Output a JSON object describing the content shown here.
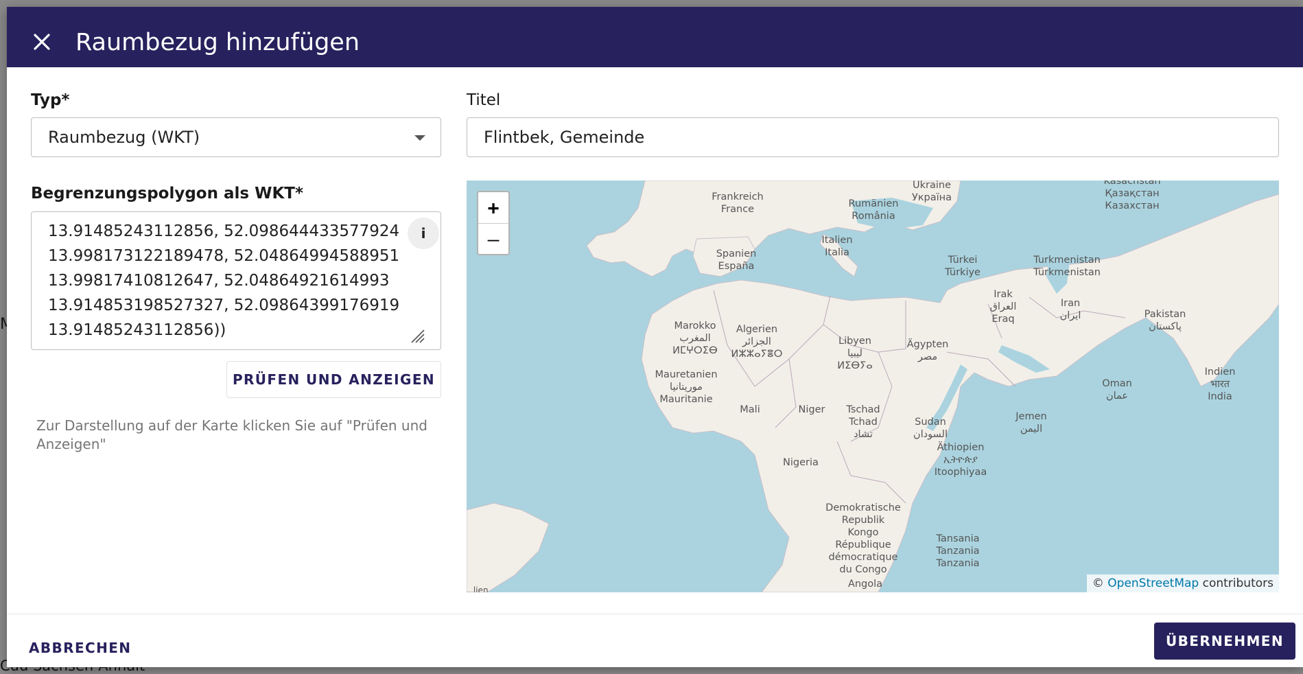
{
  "backdrop": {
    "left_text": "M",
    "bottom_text": "Cüü Sachsen-Anhalt"
  },
  "dialog": {
    "title": "Raumbezug hinzufügen",
    "close_icon": "close-icon"
  },
  "form": {
    "type_label": "Typ*",
    "type_value": "Raumbezug (WKT)",
    "title_label": "Titel",
    "title_value": "Flintbek, Gemeinde",
    "wkt_label": "Begrenzungspolygon als WKT*",
    "wkt_lines": [
      "13.91485243112856, 52.098644433577924",
      "13.998173122189478, 52.04864994588951",
      "13.99817410812647, 52.04864921614993",
      "13.914853198527327, 52.09864399176919",
      "13.91485243112856))"
    ],
    "info_icon_label": "i",
    "check_button": "PRÜFEN UND ANZEIGEN",
    "hint": "Zur Darstellung auf der Karte klicken Sie auf \"Prüfen und Anzeigen\""
  },
  "map": {
    "zoom_in": "+",
    "zoom_out": "–",
    "attribution_prefix": "©",
    "attribution_link": "OpenStreetMap",
    "attribution_suffix": "contributors",
    "labels": {
      "ukraine": "Ukraine\nУкраїна",
      "kazakhstan": "Kasachstan\nҚазақстан\nКазахстан",
      "france": "Frankreich\nFrance",
      "romania": "Rumänien\nRomânia",
      "italy": "Italien\nItalia",
      "spain": "Spanien\nEspaña",
      "turkey": "Türkei\nTürkiye",
      "turkmenistan": "Turkmenistan\nTürkmenistan",
      "iraq": "Irak\nالعراق\nEraq",
      "iran": "Iran\nایران",
      "pakistan": "Pakistan\nپاکستان",
      "morocco": "Marokko\nالمغرب\nⵍⵎⵖⵔⵉⴱ",
      "algeria": "Algerien\nالجزائر\nⵍⵣⵣⴰⵢⴻⵔ",
      "libya": "Libyen\nليبيا\nⵍⵉⴱⵢⴰ",
      "egypt": "Ägypten\nمصر",
      "mauritania": "Mauretanien\nموريتانيا\nMauritanie",
      "mali": "Mali",
      "niger": "Niger",
      "chad": "Tschad\nTchad\nتشاد",
      "sudan": "Sudan\nالسودان",
      "oman": "Oman\nعمان",
      "india": "Indien\nभारत\nIndia",
      "yemen": "Jemen\nاليمن",
      "ethiopia": "Äthiopien\nኢትዮጵያ\nItoophiyaa",
      "nigeria": "Nigeria",
      "drc": "Demokratische\nRepublik\nKongo\nRépublique\ndémocratique\ndu Congo",
      "tanzania": "Tansania\nTanzania\nTanzania",
      "angola": "Angola",
      "partial": "...lien"
    }
  },
  "footer": {
    "cancel": "ABBRECHEN",
    "apply": "ÜBERNEHMEN"
  },
  "colors": {
    "header": "#27215d",
    "water": "#aad3df",
    "land": "#f2efe9"
  }
}
